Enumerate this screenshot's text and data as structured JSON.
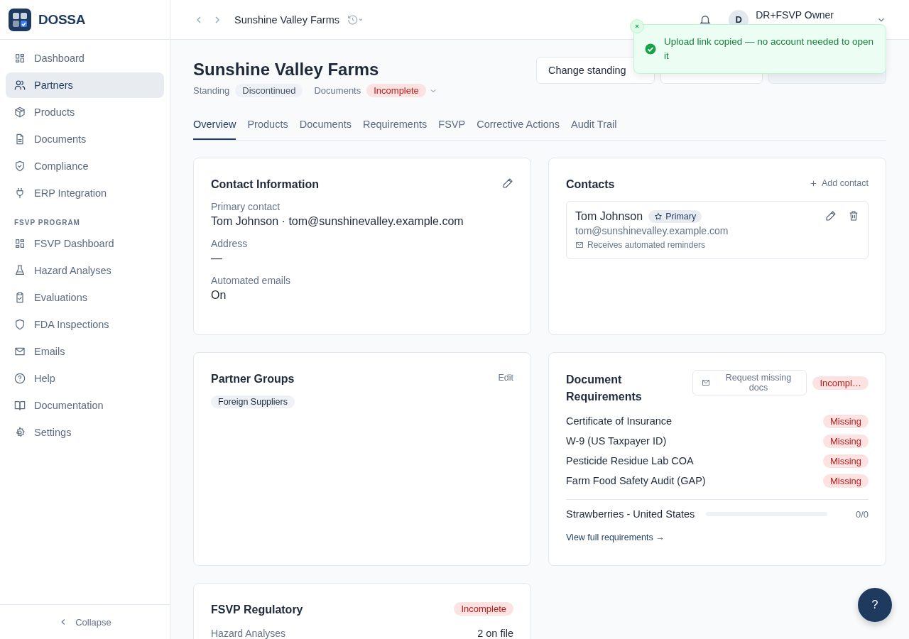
{
  "brand": "DOSSA",
  "sidebar": {
    "items": [
      {
        "label": "Dashboard",
        "kind": "grid",
        "selected": false
      },
      {
        "label": "Partners",
        "kind": "users",
        "selected": true
      },
      {
        "label": "Products",
        "kind": "box",
        "selected": false
      },
      {
        "label": "Documents",
        "kind": "file",
        "selected": false
      },
      {
        "label": "Compliance",
        "kind": "shieldcheck",
        "selected": false
      },
      {
        "label": "ERP Integration",
        "kind": "plug",
        "selected": false
      }
    ],
    "section": "FSVP PROGRAM",
    "program_items": [
      {
        "label": "FSVP Dashboard",
        "kind": "grid",
        "selected": false
      },
      {
        "label": "Hazard Analyses",
        "kind": "flask",
        "selected": false
      },
      {
        "label": "Evaluations",
        "kind": "clipboard",
        "selected": false
      },
      {
        "label": "FDA Inspections",
        "kind": "shield",
        "selected": false
      },
      {
        "label": "Emails",
        "kind": "mail",
        "selected": false
      },
      {
        "label": "Help",
        "kind": "help",
        "selected": false
      },
      {
        "label": "Documentation",
        "kind": "book",
        "selected": false
      },
      {
        "label": "Settings",
        "kind": "gear",
        "selected": false
      }
    ],
    "collapse": "Collapse"
  },
  "topbar": {
    "breadcrumb": "Sunshine Valley Farms",
    "user": {
      "initial": "D",
      "name": "DR+FSVP Owner"
    }
  },
  "toast": {
    "message": "Upload link copied — no account needed to open it"
  },
  "header": {
    "title": "Sunshine Valley Farms",
    "standing_label": "Standing",
    "standing": "Discontinued",
    "documents_label": "Documents",
    "documents_status": "Incomplete",
    "action": "Change standing"
  },
  "tabs": [
    {
      "label": "Overview",
      "selected": true
    },
    {
      "label": "Products",
      "selected": false
    },
    {
      "label": "Documents",
      "selected": false
    },
    {
      "label": "Requirements",
      "selected": false
    },
    {
      "label": "FSVP",
      "selected": false
    },
    {
      "label": "Corrective Actions",
      "selected": false
    },
    {
      "label": "Audit Trail",
      "selected": false
    }
  ],
  "contact_info": {
    "title": "Contact Information",
    "fields": [
      {
        "label": "Primary contact",
        "value": "Tom Johnson · tom@sunshinevalley.example.com"
      },
      {
        "label": "Address",
        "value": "—"
      },
      {
        "label": "Automated emails",
        "value": "On"
      }
    ]
  },
  "contacts": {
    "title": "Contacts",
    "add": "Add contact",
    "items": [
      {
        "name": "Tom Johnson",
        "badge": "Primary",
        "email": "tom@sunshinevalley.example.com",
        "note": "Receives automated reminders"
      }
    ]
  },
  "partner_groups": {
    "title": "Partner Groups",
    "edit": "Edit",
    "groups": [
      "Foreign Suppliers"
    ]
  },
  "doc_requirements": {
    "title": "Document Requirements",
    "request": "Request missing docs",
    "status": "Incompl…",
    "items": [
      {
        "name": "Certificate of Insurance",
        "status": "Missing"
      },
      {
        "name": "W-9 (US Taxpayer ID)",
        "status": "Missing"
      },
      {
        "name": "Pesticide Residue Lab COA",
        "status": "Missing"
      },
      {
        "name": "Farm Food Safety Audit (GAP)",
        "status": "Missing"
      }
    ],
    "product": {
      "name": "Strawberries - United States",
      "level": 0,
      "count": "0/0"
    },
    "link": "View full requirements →"
  },
  "fsvp": {
    "title": "FSVP Regulatory",
    "status": "Incomplete",
    "rows": [
      {
        "label": "Hazard Analyses",
        "value": "2 on file"
      }
    ]
  },
  "help_button": "?"
}
